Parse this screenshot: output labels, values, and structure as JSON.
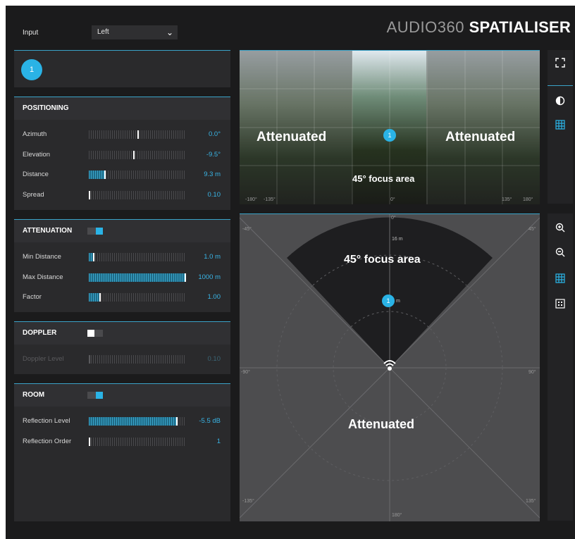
{
  "header": {
    "input_label": "Input",
    "input_value": "Left",
    "brand_light": "AUDIO360",
    "brand_bold": "SPATIALISER"
  },
  "source_badge": "1",
  "positioning": {
    "title": "POSITIONING",
    "rows": [
      {
        "label": "Azimuth",
        "value": "0.0°",
        "level": 0.5
      },
      {
        "label": "Elevation",
        "value": "-9.5°",
        "level": 0.46
      },
      {
        "label": "Distance",
        "value": "9.3 m",
        "level": 0.16,
        "filled": true
      },
      {
        "label": "Spread",
        "value": "0.10",
        "level": 0.0
      }
    ]
  },
  "attenuation": {
    "title": "ATTENUATION",
    "enabled": true,
    "rows": [
      {
        "label": "Min Distance",
        "value": "1.0 m",
        "level": 0.04,
        "filled": true
      },
      {
        "label": "Max Distance",
        "value": "1000 m",
        "level": 1.0,
        "filled": true
      },
      {
        "label": "Factor",
        "value": "1.00",
        "level": 0.11,
        "filled": true
      }
    ]
  },
  "doppler": {
    "title": "DOPPLER",
    "enabled": false,
    "rows": [
      {
        "label": "Doppler Level",
        "value": "0.10",
        "level": 0.0
      }
    ]
  },
  "room": {
    "title": "ROOM",
    "enabled": true,
    "rows": [
      {
        "label": "Reflection Level",
        "value": "-5.5 dB",
        "level": 0.9,
        "filled": true
      },
      {
        "label": "Reflection Order",
        "value": "1",
        "level": 0.0
      }
    ]
  },
  "top_view": {
    "left_label": "Attenuated",
    "right_label": "Attenuated",
    "focus_label": "45° focus area",
    "badge": "1",
    "ticks": [
      "-180°",
      "-135°",
      "0°",
      "135°",
      "180°"
    ]
  },
  "bottom_view": {
    "focus_label": "45° focus area",
    "attenuated_label": "Attenuated",
    "badge": "1",
    "distance_label": "16 m",
    "badge_unit": "m",
    "angles": {
      "top": "0°",
      "tl": "-45°",
      "tr": "45°",
      "left": "-90°",
      "right": "90°",
      "bl": "-135°",
      "br": "135°",
      "bottom": "180°"
    }
  },
  "colors": {
    "accent": "#2ab3e6",
    "background": "#1b1b1c",
    "panel": "#2a2a2c"
  },
  "icons": [
    "fullscreen-icon",
    "contrast-icon",
    "grid-icon",
    "zoom-in-icon",
    "zoom-out-icon",
    "grid-icon",
    "dots-grid-icon"
  ]
}
